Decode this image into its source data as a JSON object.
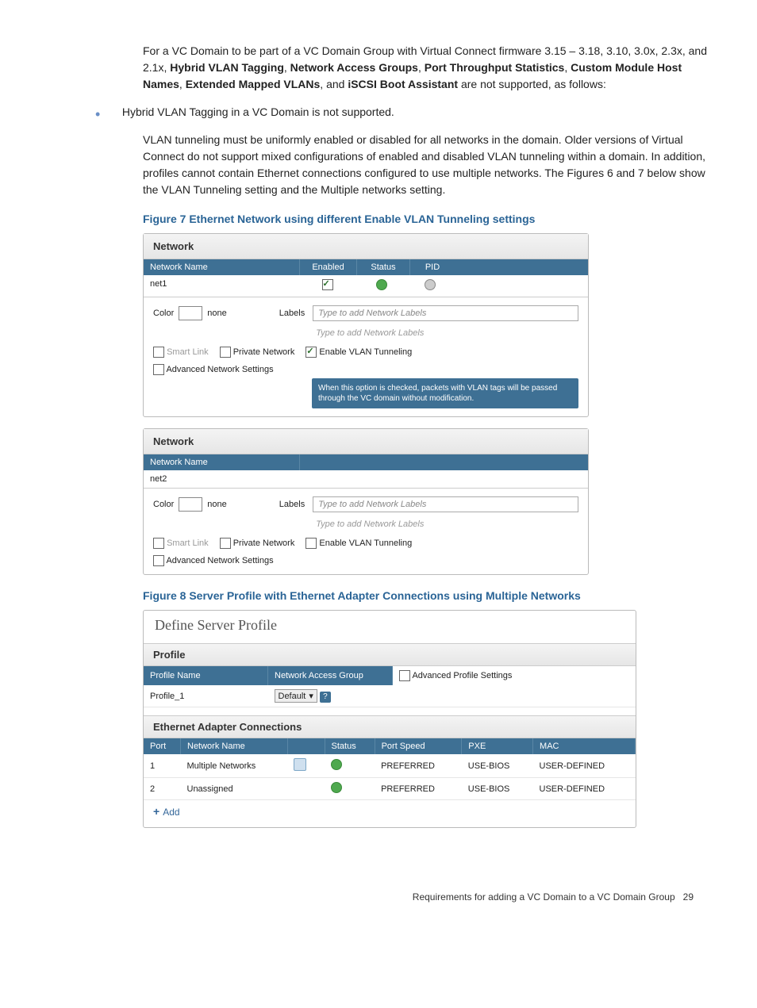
{
  "intro": {
    "pre": "For a VC Domain to be part of a VC Domain Group with Virtual Connect firmware 3.15 – 3.18, 3.10, 3.0x, 2.3x, and 2.1x, ",
    "bold_terms": [
      "Hybrid VLAN Tagging",
      "Network Access Groups",
      "Port Throughput Statistics",
      "Custom Module Host Names",
      "Extended Mapped VLANs",
      "iSCSI Boot Assistant"
    ],
    "mid1": ", ",
    "mid2": ", and ",
    "post": " are not supported, as follows:"
  },
  "bullet1": "Hybrid VLAN Tagging in a VC Domain is not supported.",
  "bullet1_para": "VLAN tunneling must be uniformly enabled or disabled for all networks in the domain. Older versions of Virtual Connect do not support mixed configurations of enabled and disabled VLAN tunneling within a domain. In addition, profiles cannot contain Ethernet connections configured to use multiple networks. The Figures 6 and 7 below show the VLAN Tunneling setting and the Multiple networks setting.",
  "fig7_caption": "Figure 7 Ethernet Network using different Enable VLAN Tunneling settings",
  "net_panel": {
    "header": "Network",
    "cols": [
      "Network Name",
      "Enabled",
      "Status",
      "PID"
    ],
    "color_label": "Color",
    "color_value": "none",
    "labels_label": "Labels",
    "labels_placeholder": "Type to add Network Labels",
    "smart_link": "Smart Link",
    "private_network": "Private Network",
    "vlan_tunnel": "Enable VLAN Tunneling",
    "adv_settings": "Advanced Network Settings",
    "tooltip": "When this option is checked, packets with VLAN tags will be passed through the VC domain without modification.",
    "rows": [
      {
        "name": "net1",
        "enabled": true,
        "status": "ok",
        "pid": true,
        "vlan_checked": true,
        "smart_disabled": true
      },
      {
        "name": "net2",
        "enabled": null,
        "status": null,
        "pid": null,
        "vlan_checked": false,
        "smart_disabled": true
      }
    ]
  },
  "fig8_caption": "Figure 8 Server Profile with Ethernet Adapter Connections using Multiple Networks",
  "fig8": {
    "title": "Define Server Profile",
    "profile_section": "Profile",
    "profile_name_hdr": "Profile Name",
    "nag_hdr": "Network Access Group",
    "adv_profile": "Advanced Profile Settings",
    "profile_name": "Profile_1",
    "nag_value": "Default",
    "eac_section": "Ethernet Adapter Connections",
    "cols": [
      "Port",
      "Network Name",
      "",
      "Status",
      "Port Speed",
      "PXE",
      "MAC"
    ],
    "rows": [
      {
        "port": "1",
        "name": "Multiple Networks",
        "edit": true,
        "status": "ok",
        "speed": "PREFERRED",
        "pxe": "USE-BIOS",
        "mac": "USER-DEFINED"
      },
      {
        "port": "2",
        "name": "Unassigned",
        "edit": false,
        "status": "ok",
        "speed": "PREFERRED",
        "pxe": "USE-BIOS",
        "mac": "USER-DEFINED"
      }
    ],
    "add": "Add"
  },
  "footer": {
    "text": "Requirements for adding a VC Domain to a VC Domain Group",
    "page": "29"
  }
}
